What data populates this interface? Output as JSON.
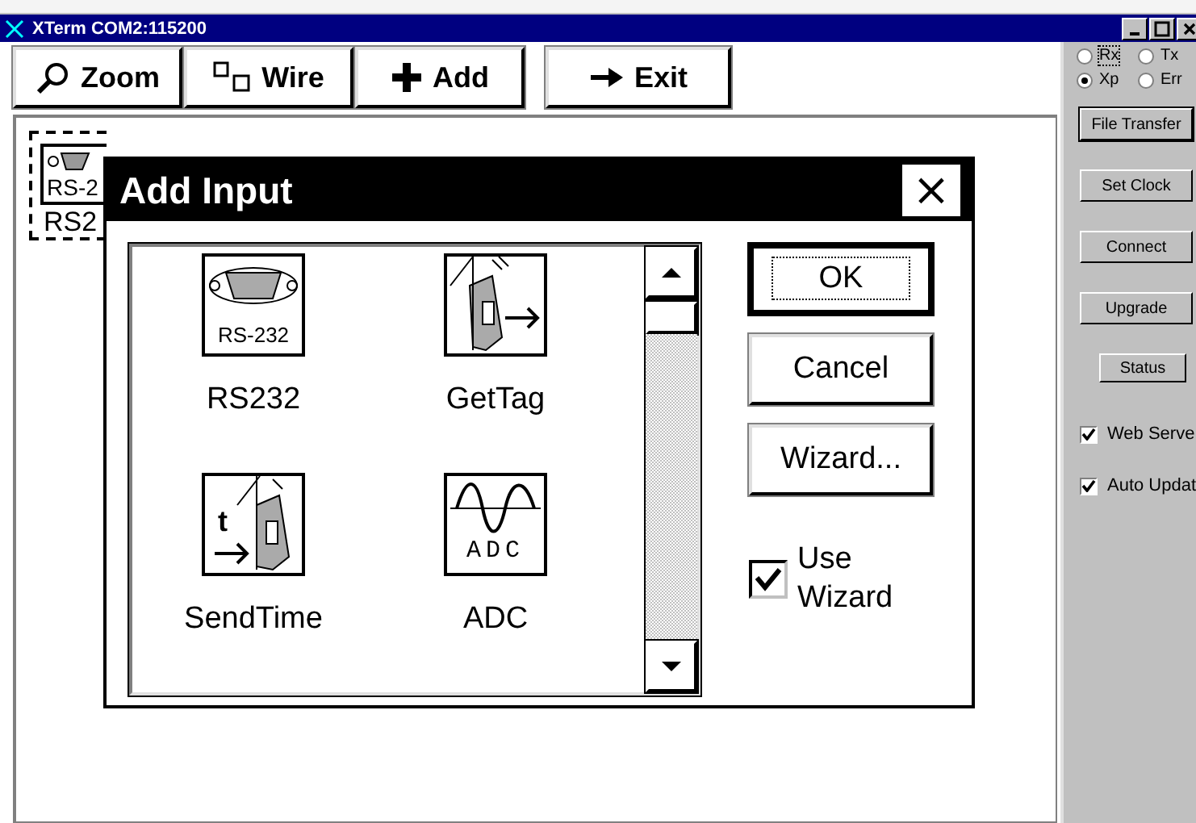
{
  "window": {
    "title": "XTerm COM2:115200"
  },
  "toolbar": {
    "buttons": [
      {
        "label": "Zoom"
      },
      {
        "label": "Wire"
      },
      {
        "label": "Add"
      },
      {
        "label": "Exit"
      }
    ]
  },
  "canvas": {
    "nodes": [
      {
        "icon_text": "RS-2",
        "label": "RS2",
        "selected": true
      }
    ]
  },
  "dialog": {
    "title": "Add Input",
    "close": "×",
    "items": [
      {
        "label": "RS232",
        "icon_text": "RS-232"
      },
      {
        "label": "GetTag"
      },
      {
        "label": "SendTime",
        "icon_text": "t"
      },
      {
        "label": "ADC",
        "icon_text": "ADC"
      }
    ],
    "buttons": [
      {
        "label": "OK",
        "default": true
      },
      {
        "label": "Cancel",
        "default": false
      },
      {
        "label": "Wizard...",
        "default": false
      }
    ],
    "use_wizard": {
      "label": "Use Wizard",
      "checked": true
    }
  },
  "side_panel": {
    "radios": [
      {
        "label": "Rx",
        "selected": false,
        "focused": true
      },
      {
        "label": "Tx",
        "selected": false,
        "focused": false
      },
      {
        "label": "Xp",
        "selected": true,
        "focused": false
      },
      {
        "label": "Err",
        "selected": false,
        "focused": false
      }
    ],
    "buttons": [
      {
        "label": "File Transfer",
        "default": true,
        "kind": "wide"
      },
      {
        "label": "Set Clock",
        "default": false,
        "kind": "wide"
      },
      {
        "label": "Connect",
        "default": false,
        "kind": "wide"
      },
      {
        "label": "Upgrade",
        "default": false,
        "kind": "wide"
      },
      {
        "label": "Status",
        "default": false,
        "kind": "narrow"
      }
    ],
    "checkboxes": [
      {
        "label": "Web Serve",
        "checked": true
      },
      {
        "label": "Auto Updat",
        "checked": true
      }
    ]
  }
}
